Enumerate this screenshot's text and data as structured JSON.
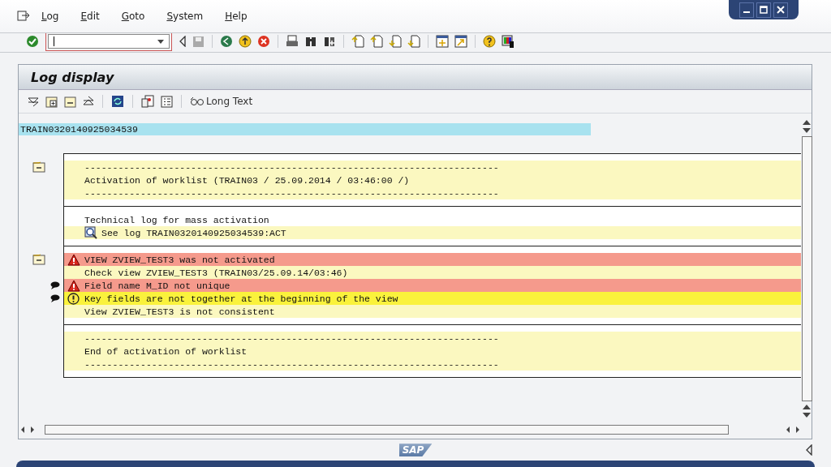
{
  "menu": [
    {
      "label": "Log"
    },
    {
      "label": "Edit"
    },
    {
      "label": "Goto"
    },
    {
      "label": "System"
    },
    {
      "label": "Help"
    }
  ],
  "title": "Log display",
  "long_text_button": "Long Text",
  "log_id": "TRAIN0320140925034539",
  "blocks": [
    {
      "lines": [
        {
          "kind": "info",
          "text": "--------------------------------------------------------------------------",
          "detail_icon": true
        },
        {
          "kind": "info",
          "text": "Activation of worklist (TRAIN03 / 25.09.2014 / 03:46:00 /)"
        },
        {
          "kind": "info",
          "text": "--------------------------------------------------------------------------"
        }
      ]
    },
    {
      "lines": [
        {
          "kind": "plain",
          "text": "Technical log for mass activation"
        },
        {
          "kind": "link",
          "text": "See log TRAIN0320140925034539:ACT"
        }
      ]
    },
    {
      "lines": [
        {
          "kind": "error",
          "text": "VIEW ZVIEW_TEST3 was not activated",
          "detail_icon": true
        },
        {
          "kind": "info",
          "text": "Check view ZVIEW_TEST3 (TRAIN03/25.09.14/03:46)"
        },
        {
          "kind": "error",
          "text": "Field name M_ID not unique",
          "comment_icon": true
        },
        {
          "kind": "warning",
          "text": "Key fields are not together at the beginning of the view",
          "comment_icon": true
        },
        {
          "kind": "info",
          "text": "View ZVIEW_TEST3 is not consistent"
        }
      ]
    },
    {
      "lines": [
        {
          "kind": "info",
          "text": "--------------------------------------------------------------------------"
        },
        {
          "kind": "info",
          "text": "End of activation of worklist"
        },
        {
          "kind": "info",
          "text": "--------------------------------------------------------------------------"
        }
      ]
    }
  ],
  "logo": "SAP"
}
